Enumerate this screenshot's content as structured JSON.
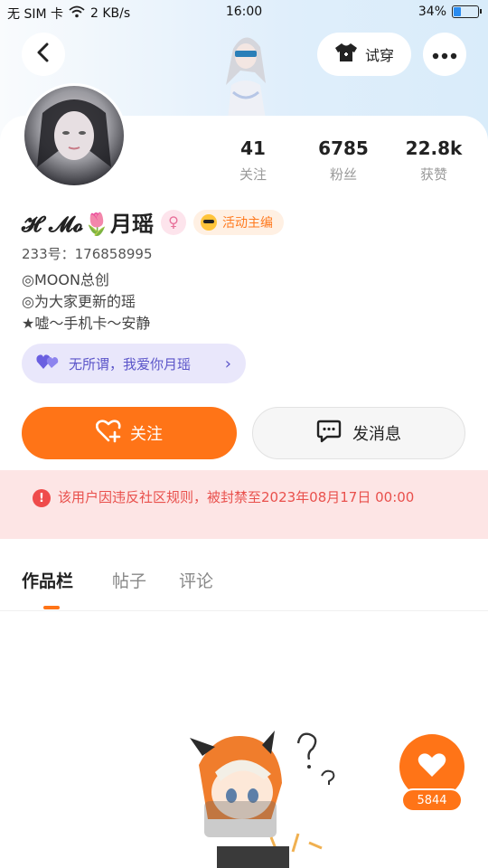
{
  "status_bar": {
    "carrier": "无 SIM 卡",
    "speed": "2 KB/s",
    "time": "16:00",
    "battery_text": "34%",
    "battery_level": 0.34
  },
  "header": {
    "try_on_label": "试穿",
    "icons": {
      "back": "back-icon",
      "tshirt": "tshirt-icon",
      "more": "more-icon"
    }
  },
  "profile": {
    "stats": [
      {
        "value": "41",
        "label": "关注"
      },
      {
        "value": "6785",
        "label": "粉丝"
      },
      {
        "value": "22.8k",
        "label": "获赞"
      }
    ],
    "name": "𝓗   𝓜𝓸🌷月瑶",
    "gender_symbol": "♀",
    "badge_label": "活动主编",
    "uid": "233号：176858995",
    "bio": [
      "◎MOON总创",
      "◎为大家更新的瑶",
      "★嘘～手机卡～安静"
    ],
    "love_pill": "无所谓，我爱你月瑶"
  },
  "actions": {
    "follow_label": "关注",
    "message_label": "发消息"
  },
  "ban_notice": "该用户因违反社区规则，被封禁至2023年08月17日 00:00",
  "tabs": [
    "作品栏",
    "帖子",
    "评论"
  ],
  "active_tab": 0,
  "like_fab": {
    "count": "5844"
  },
  "colors": {
    "accent": "#ff7417",
    "ban_bg": "#fde5e5",
    "ban_text": "#e9504c",
    "pill_bg": "#e9e7fb",
    "pill_text": "#5b55c9"
  }
}
